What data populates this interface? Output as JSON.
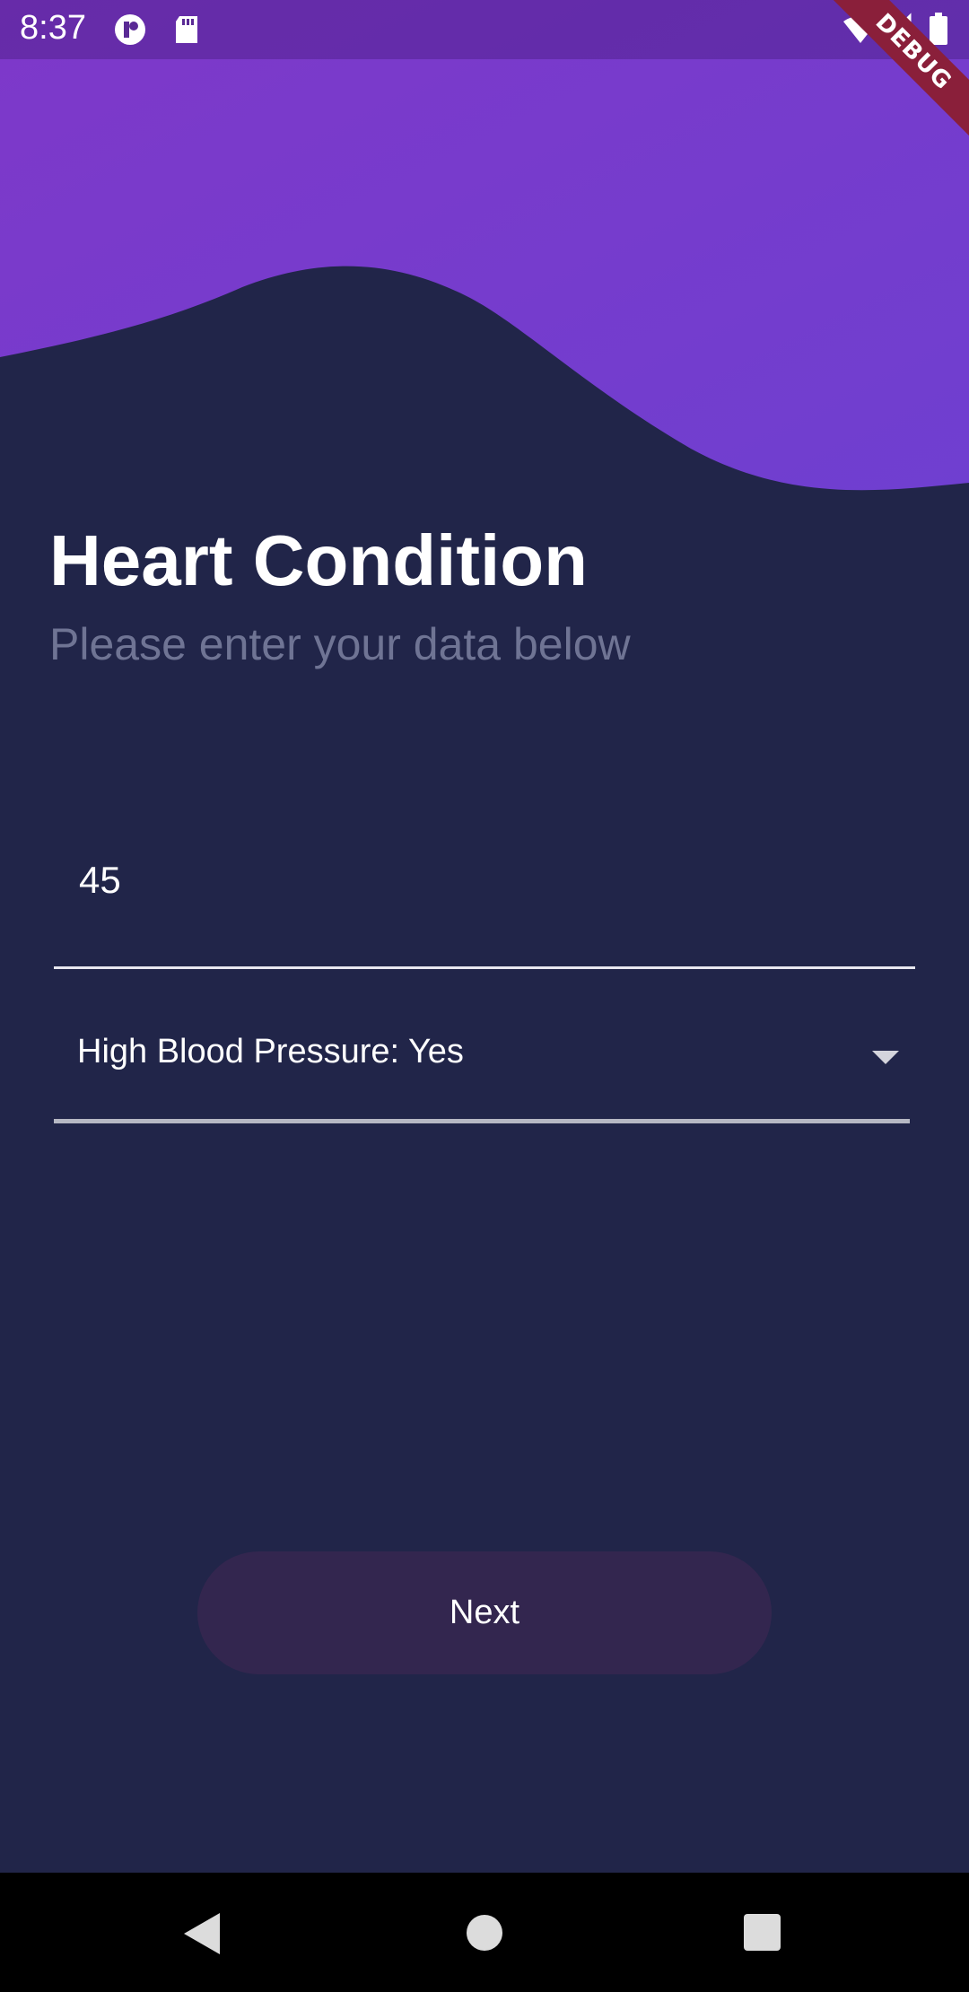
{
  "status_bar": {
    "time": "8:37",
    "icons": [
      "app-notification-icon",
      "sd-card-icon",
      "wifi-icon",
      "signal-icon",
      "battery-icon"
    ]
  },
  "debug_banner": {
    "label": "DEBUG"
  },
  "header": {
    "title": "Heart Condition",
    "subtitle": "Please enter your data below"
  },
  "form": {
    "age_field": {
      "value": "45"
    },
    "blood_pressure_dropdown": {
      "selected": "High Blood Pressure: Yes"
    }
  },
  "actions": {
    "next_label": "Next"
  },
  "nav_bar": {
    "icons": [
      "back-icon",
      "home-icon",
      "recents-icon"
    ]
  },
  "colors": {
    "background": "#212549",
    "wave_start": "#7e38c9",
    "wave_end": "#6f3fd0",
    "button": "#33264f",
    "subtitle": "#6f7494",
    "debug_ribbon": "#8a1f3a"
  }
}
